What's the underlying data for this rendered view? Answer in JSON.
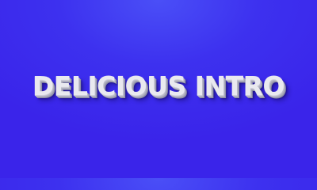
{
  "intro": {
    "title": "DELICIOUS INTRO"
  },
  "colors": {
    "background": "#3d31ef",
    "text": "#e9e9ef"
  }
}
